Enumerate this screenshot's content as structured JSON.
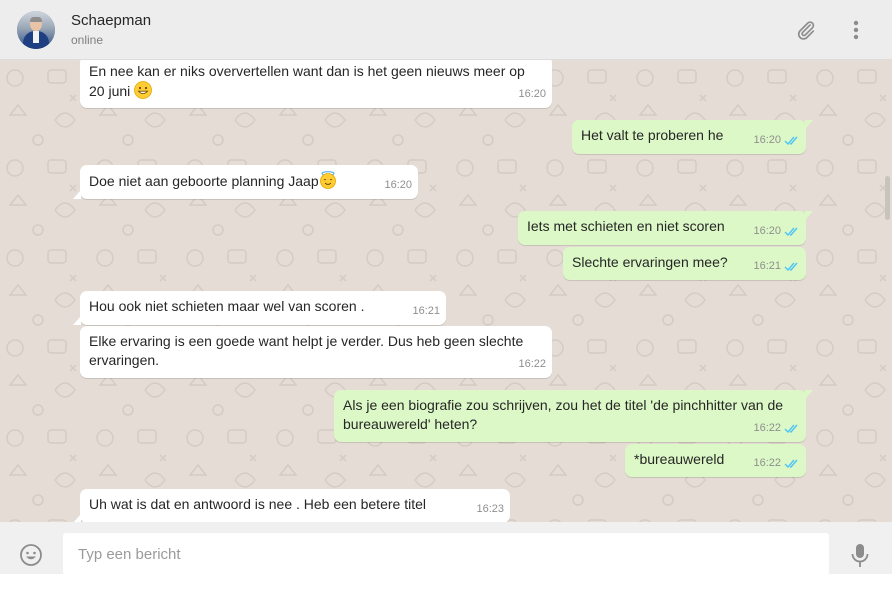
{
  "header": {
    "contact_name": "Schaepman",
    "status": "online",
    "icons": [
      "paperclip-icon",
      "more-vert-icon"
    ]
  },
  "messages": [
    {
      "direction": "in",
      "text": "En nee kan er niks oververtellen want dan is het geen nieuws meer op 20 juni",
      "emoji": "grinning-face-emoji",
      "time": "16:20"
    },
    {
      "direction": "out",
      "text": "Het valt te proberen he",
      "time": "16:20",
      "status": "read"
    },
    {
      "direction": "in",
      "text": "Doe niet aan geboorte planning Jaap",
      "emoji": "halo-face-emoji",
      "time": "16:20"
    },
    {
      "direction": "out",
      "text": "Iets met schieten en niet scoren",
      "time": "16:20",
      "status": "read"
    },
    {
      "direction": "out",
      "text": "Slechte ervaringen mee?",
      "time": "16:21",
      "status": "read"
    },
    {
      "direction": "in",
      "text": "Hou ook niet schieten maar wel van scoren .",
      "time": "16:21"
    },
    {
      "direction": "in",
      "text": "Elke ervaring is een goede want helpt je verder. Dus heb geen slechte ervaringen.",
      "time": "16:22"
    },
    {
      "direction": "out",
      "text": "Als je een biografie zou schrijven, zou het de titel 'de pinchhitter van de bureauwereld' heten?",
      "time": "16:22",
      "status": "read"
    },
    {
      "direction": "out",
      "text": "*bureauwereld",
      "time": "16:22",
      "status": "read"
    },
    {
      "direction": "in",
      "text": "Uh wat is dat en antwoord is nee . Heb een betere titel",
      "time": "16:23"
    }
  ],
  "composer": {
    "placeholder": "Typ een bericht",
    "icons": [
      "smiley-icon",
      "microphone-icon"
    ]
  },
  "colors": {
    "chat_bg": "#e5ddd5",
    "incoming_bubble": "#ffffff",
    "outgoing_bubble": "#dcf8c6",
    "read_ticks": "#4fc3f7",
    "header_bg": "#ededed"
  }
}
